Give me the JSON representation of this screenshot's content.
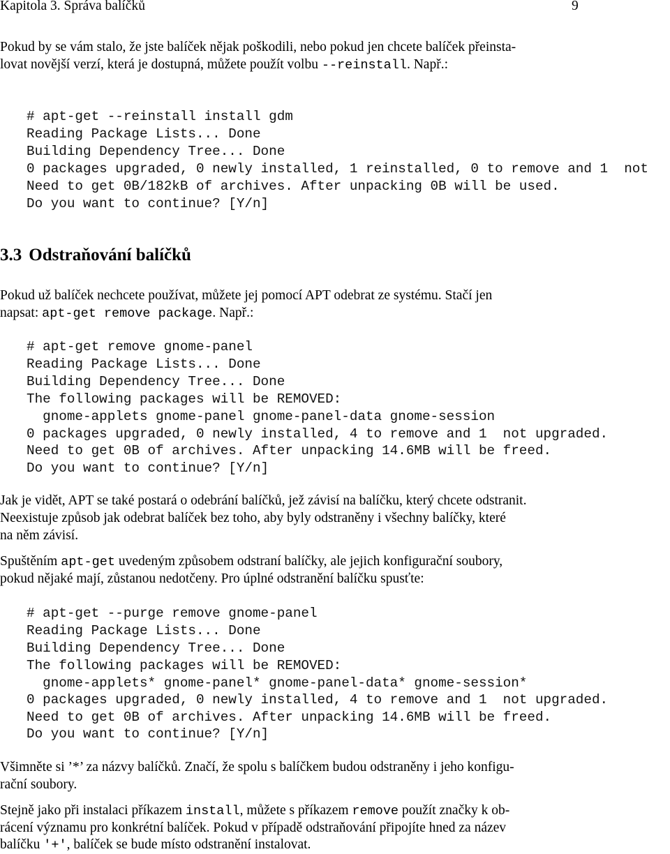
{
  "header": {
    "chapter": "Kapitola 3. Správa balíčků",
    "page_number": "9"
  },
  "section": {
    "number": "3.3",
    "title": "Odstraňování balíčků"
  },
  "blocks": [
    {
      "type": "para",
      "name": "paragraph-reinstall",
      "lines": [
        [
          {
            "t": "Pokud by se vám stalo, že jste balíček nějak poškodili, nebo pokud jen chcete balíček přeinsta-"
          }
        ],
        [
          {
            "t": "lovat novější verzí, která je dostupná, můžete použít volbu "
          },
          {
            "t": "--reinstall",
            "code": true
          },
          {
            "t": ". Např.:"
          }
        ]
      ]
    },
    {
      "type": "code",
      "name": "code-reinstall",
      "lines": [
        "# apt-get --reinstall install gdm",
        "Reading Package Lists... Done",
        "Building Dependency Tree... Done",
        "0 packages upgraded, 0 newly installed, 1 reinstalled, 0 to remove and 1  not",
        "Need to get 0B/182kB of archives. After unpacking 0B will be used.",
        "Do you want to continue? [Y/n]"
      ]
    },
    {
      "type": "para",
      "name": "paragraph-remove",
      "lines": [
        [
          {
            "t": "Pokud už balíček nechcete používat, můžete jej pomocí APT odebrat ze systému. Stačí jen"
          }
        ],
        [
          {
            "t": "napsat: "
          },
          {
            "t": "apt-get remove package",
            "code": true
          },
          {
            "t": ". Např.:"
          }
        ]
      ]
    },
    {
      "type": "code",
      "name": "code-remove",
      "lines": [
        "# apt-get remove gnome-panel",
        "Reading Package Lists... Done",
        "Building Dependency Tree... Done",
        "The following packages will be REMOVED:",
        "  gnome-applets gnome-panel gnome-panel-data gnome-session",
        "0 packages upgraded, 0 newly installed, 4 to remove and 1  not upgraded.",
        "Need to get 0B of archives. After unpacking 14.6MB will be freed.",
        "Do you want to continue? [Y/n]"
      ]
    },
    {
      "type": "para",
      "name": "paragraph-dependencies",
      "lines": [
        [
          {
            "t": "Jak je vidět, APT se také postará o odebrání balíčků, jež závisí na balíčku, který chcete odstranit."
          }
        ],
        [
          {
            "t": "Neexistuje způsob jak odebrat balíček bez toho, aby byly odstraněny i všechny balíčky, které"
          }
        ],
        [
          {
            "t": "na něm závisí."
          }
        ]
      ]
    },
    {
      "type": "para",
      "name": "paragraph-purge",
      "lines": [
        [
          {
            "t": "Spuštěním "
          },
          {
            "t": "apt-get",
            "code": true
          },
          {
            "t": " uvedeným způsobem odstraní balíčky, ale jejich konfigurační soubory,"
          }
        ],
        [
          {
            "t": "pokud nějaké mají, zůstanou nedotčeny. Pro úplné odstranění balíčku spusťte:"
          }
        ]
      ]
    },
    {
      "type": "code",
      "name": "code-purge",
      "lines": [
        "# apt-get --purge remove gnome-panel",
        "Reading Package Lists... Done",
        "Building Dependency Tree... Done",
        "The following packages will be REMOVED:",
        "  gnome-applets* gnome-panel* gnome-panel-data* gnome-session*",
        "0 packages upgraded, 0 newly installed, 4 to remove and 1  not upgraded.",
        "Need to get 0B of archives. After unpacking 14.6MB will be freed.",
        "Do you want to continue? [Y/n]"
      ]
    },
    {
      "type": "para",
      "name": "paragraph-asterisk",
      "lines": [
        [
          {
            "t": "Všimněte si ’*’ za názvy balíčků. Značí, že spolu s balíčkem budou odstraněny i jeho konfigu-"
          }
        ],
        [
          {
            "t": "rační soubory."
          }
        ]
      ]
    },
    {
      "type": "para",
      "name": "paragraph-plus",
      "lines": [
        [
          {
            "t": "Stejně jako při instalaci příkazem "
          },
          {
            "t": "install",
            "code": true
          },
          {
            "t": ", můžete s příkazem "
          },
          {
            "t": "remove",
            "code": true
          },
          {
            "t": " použít značky k ob-"
          }
        ],
        [
          {
            "t": "rácení významu pro konkrétní balíček. Pokud v případě odstraňování připojíte hned za název"
          }
        ],
        [
          {
            "t": "balíčku "
          },
          {
            "t": "'+'",
            "code": true
          },
          {
            "t": ", balíček se bude místo odstranění instalovat."
          }
        ]
      ]
    }
  ]
}
